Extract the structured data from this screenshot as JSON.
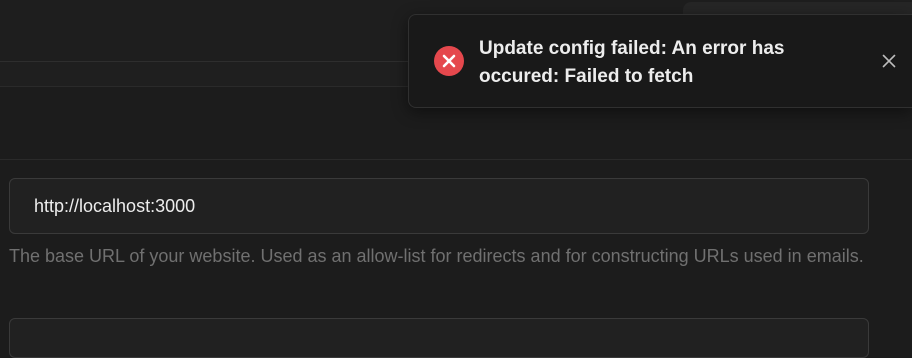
{
  "settings": {
    "site_url_value": "http://localhost:3000",
    "site_url_helper": "The base URL of your website. Used as an allow-list for redirects and for constructing URLs used in emails."
  },
  "toast": {
    "message": "Update config failed: An error has occured: Failed to fetch",
    "status": "error",
    "status_color": "#e5484d",
    "icon": "error-x-icon",
    "close_icon": "close-icon"
  }
}
